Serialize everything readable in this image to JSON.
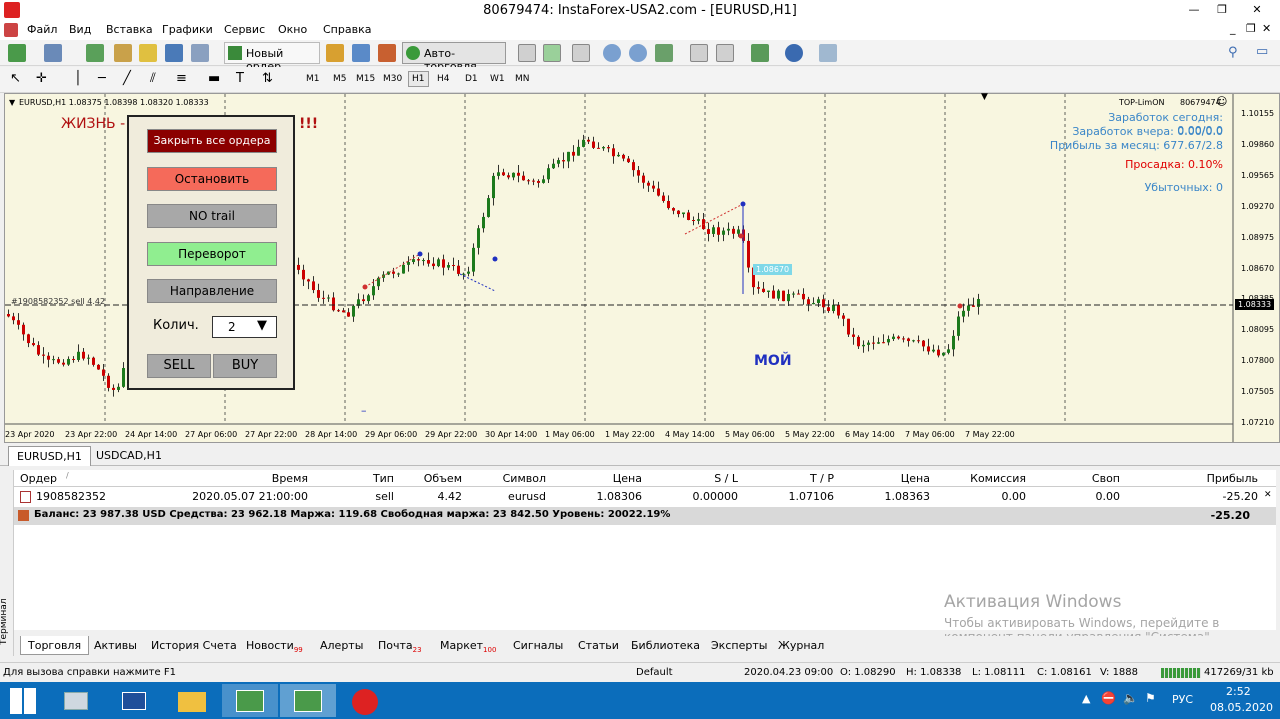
{
  "window": {
    "title": "80679474: InstaForex-USA2.com - [EURUSD,H1]"
  },
  "menu": [
    "Файл",
    "Вид",
    "Вставка",
    "Графики",
    "Сервис",
    "Окно",
    "Справка"
  ],
  "toolbar1": {
    "new_order": "Новый ордер",
    "auto_trading": "Авто-торговля"
  },
  "timeframes": [
    "M1",
    "M5",
    "M15",
    "M30",
    "H1",
    "H4",
    "D1",
    "W1",
    "MN"
  ],
  "chart": {
    "header": "EURUSD,H1  1.08375 1.08398 1.08320 1.08333",
    "label_life": "ЖИЗНЬ -",
    "label_exclaim": "!!!",
    "order_line_label": "#1908582352 sell 4.42",
    "label_moy": "МОЙ",
    "price_tag_blue": "1.08670",
    "current_price": "1.08333",
    "ea_name": "TOP-LimON",
    "account": "80679474",
    "earned_today": "Заработок сегодня: 0.00/0.0",
    "earned_yesterday": "Заработок вчера: 0.00/0.0",
    "month_profit": "Прибыль за месяц: 677.67/2.8",
    "drawdown": "Просадка: 0.10%",
    "losing": "Убыточных: 0",
    "y_ticks": [
      "1.10155",
      "1.09860",
      "1.09565",
      "1.09270",
      "1.08975",
      "1.08670",
      "1.08385",
      "1.08095",
      "1.07800",
      "1.07505",
      "1.07210"
    ],
    "x_ticks": [
      "23 Apr 2020",
      "23 Apr 22:00",
      "24 Apr 14:00",
      "27 Apr 06:00",
      "27 Apr 22:00",
      "28 Apr 14:00",
      "29 Apr 06:00",
      "29 Apr 22:00",
      "30 Apr 14:00",
      "1 May 06:00",
      "1 May 22:00",
      "4 May 14:00",
      "5 May 06:00",
      "5 May 22:00",
      "6 May 14:00",
      "7 May 06:00",
      "7 May 22:00"
    ]
  },
  "ea_panel": {
    "close_all": "Закрыть все ордера",
    "stop": "Остановить",
    "no_trail": "NO trail",
    "reverse": "Переворот",
    "direction": "Направление",
    "qty_label": "Колич.",
    "qty_value": "2",
    "sell": "SELL",
    "buy": "BUY"
  },
  "chart_tabs": [
    "EURUSD,H1",
    "USDCAD,H1"
  ],
  "terminal": {
    "side_label": "Терминал",
    "columns": [
      "Ордер",
      "Время",
      "Тип",
      "Объем",
      "Символ",
      "Цена",
      "S / L",
      "T / P",
      "Цена",
      "Комиссия",
      "Своп",
      "Прибыль"
    ],
    "row": [
      "1908582352",
      "2020.05.07 21:00:00",
      "sell",
      "4.42",
      "eurusd",
      "1.08306",
      "0.00000",
      "1.07106",
      "1.08363",
      "0.00",
      "0.00",
      "-25.20"
    ],
    "balance": "Баланс: 23 987.38 USD  Средства: 23 962.18  Маржа: 119.68  Свободная маржа: 23 842.50  Уровень: 20022.19%",
    "balance_profit": "-25.20",
    "tabs": [
      {
        "label": "Торговля",
        "badge": ""
      },
      {
        "label": "Активы",
        "badge": ""
      },
      {
        "label": "История Счета",
        "badge": ""
      },
      {
        "label": "Новости",
        "badge": "99"
      },
      {
        "label": "Алерты",
        "badge": ""
      },
      {
        "label": "Почта",
        "badge": "23"
      },
      {
        "label": "Маркет",
        "badge": "100"
      },
      {
        "label": "Сигналы",
        "badge": ""
      },
      {
        "label": "Статьи",
        "badge": ""
      },
      {
        "label": "Библиотека",
        "badge": ""
      },
      {
        "label": "Эксперты",
        "badge": ""
      },
      {
        "label": "Журнал",
        "badge": ""
      }
    ]
  },
  "watermark": {
    "line1": "Активация Windows",
    "line2": "Чтобы активировать Windows, перейдите в",
    "line3": "компонент панели управления \"Система\"."
  },
  "status": {
    "help": "Для вызова справки нажмите F1",
    "profile": "Default",
    "datetime": "2020.04.23 09:00",
    "open": "O: 1.08290",
    "high": "H: 1.08338",
    "low": "L: 1.08111",
    "close": "C: 1.08161",
    "volume": "V: 1888",
    "traffic": "417269/31 kb"
  },
  "taskbar": {
    "lang": "РУС",
    "time": "2:52",
    "date": "08.05.2020"
  },
  "colors": {
    "chart_bg": "#f8f6e0",
    "bull": "#1c7a1c",
    "bear": "#cc0000",
    "close_all_btn": "#8b0000",
    "stop_btn": "#f56a5a",
    "reverse_btn": "#90ee90",
    "gray_btn": "#a8a8a8",
    "taskbar": "#0b6dbb",
    "info_blue": "#3a86c8",
    "drawdown_red": "#e00000"
  }
}
